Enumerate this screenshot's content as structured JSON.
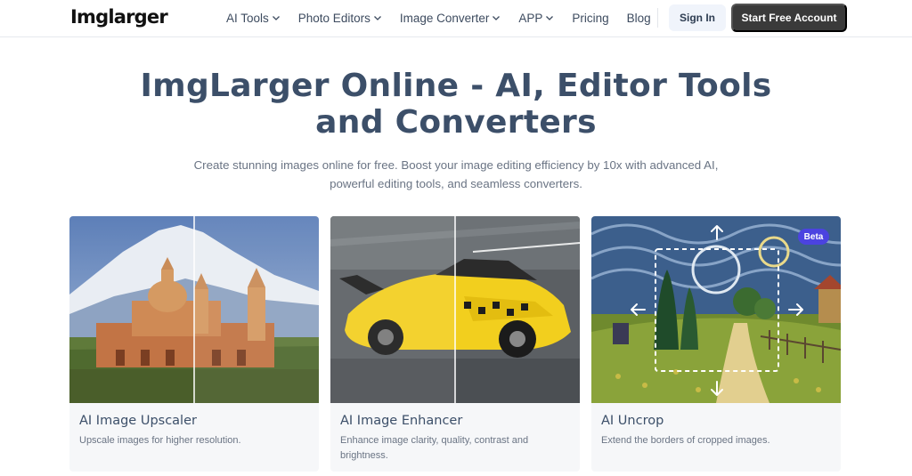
{
  "header": {
    "logo": "Imglarger",
    "nav": [
      {
        "label": "AI Tools",
        "dropdown": true
      },
      {
        "label": "Photo Editors",
        "dropdown": true
      },
      {
        "label": "Image Converter",
        "dropdown": true
      },
      {
        "label": "APP",
        "dropdown": true
      },
      {
        "label": "Pricing",
        "dropdown": false
      },
      {
        "label": "Blog",
        "dropdown": false
      }
    ],
    "sign_in": "Sign In",
    "start_free": "Start Free Account"
  },
  "hero": {
    "title_line1": "ImgLarger Online - AI, Editor Tools",
    "title_line2": "and Converters",
    "subtitle_line1": "Create stunning images online for free. Boost your image editing efficiency by 10x with advanced AI,",
    "subtitle_line2": "powerful editing tools, and seamless converters."
  },
  "cards": [
    {
      "title": "AI Image Upscaler",
      "desc": "Upscale images for higher resolution."
    },
    {
      "title": "AI Image Enhancer",
      "desc": "Enhance image clarity, quality, contrast and brightness."
    },
    {
      "title": "AI Uncrop",
      "desc": "Extend the borders of cropped images.",
      "badge": "Beta"
    }
  ]
}
